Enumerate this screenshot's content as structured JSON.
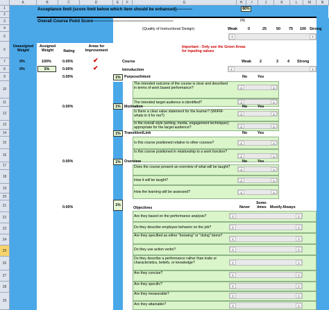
{
  "columns": [
    "A",
    "B",
    "C",
    "D",
    "E",
    "F",
    "G",
    "H",
    "I",
    "J",
    "K",
    "L",
    "M",
    "N"
  ],
  "rows": [
    "1",
    "2",
    "3",
    "4",
    "5",
    "6",
    "7",
    "8",
    "9",
    "10",
    "11",
    "12",
    "13",
    "14",
    "15",
    "16",
    "17",
    "18",
    "19",
    "20",
    "21",
    "22",
    "23",
    "24",
    "25",
    "26",
    "27",
    "28",
    "29"
  ],
  "acceptance": {
    "label": "Acceptance limit (score limit below which item should be enhanced)-----------",
    "value": "80%"
  },
  "overall": {
    "label": "Overall Course Point Score--------------------------------------------------------",
    "zero": "0%",
    "quality": "(Quality of Instructional Design)"
  },
  "scale_top": [
    "Weak",
    "0",
    "25",
    "50",
    "75",
    "100",
    "Strong"
  ],
  "headers": {
    "unassigned": "Unassigned Weight",
    "assigned": "Assigned Weight",
    "rating": "Rating",
    "areas": "Areas for Improvement"
  },
  "important": "Important - Only use the Green Areas for inputing values",
  "course": {
    "label": "Course",
    "unassigned": "0%",
    "assigned": "100%",
    "rating": "0.00%"
  },
  "course_scale": [
    "Weak",
    "2",
    "3",
    "4",
    "Strong"
  ],
  "intro": {
    "label": "Introduction",
    "unassigned": "0%",
    "assigned": "5%",
    "rating": "0.00%"
  },
  "sections": [
    {
      "label": "Purpose/Intent",
      "pct": "1%",
      "rating": "0.00%",
      "no": "No",
      "yes": "Yes",
      "questions": [
        "The intended outcome of the course is clear and described in terms of work based performance?",
        "The intended target audience is identified?"
      ]
    },
    {
      "label": "Motivation",
      "pct": "1%",
      "rating": "0.00%",
      "no": "No",
      "yes": "Yes",
      "questions": [
        "Is there a clear value statement for the learner? (WIIFM-whats in it for me?)",
        "Is the overall style (writing, media, engagement techniques) appropriate for the target audience?"
      ]
    },
    {
      "label": "Transition/Link",
      "pct": "1%",
      "rating": "0.00%",
      "no": "No",
      "yes": "Yes",
      "questions": [
        "Is this course positioned relative to other courses?",
        "Is this course positioned in relationship to a work function?"
      ]
    },
    {
      "label": "Overview",
      "pct": "1%",
      "rating": "0.00%",
      "no": "No",
      "yes": "Yes",
      "questions": [
        "Does the course present an overview of what will be taught?",
        "How it will be taught?",
        "How the learning will be assessed?"
      ]
    },
    {
      "label": "Objectives",
      "pct": "1%",
      "rating": "0.00%",
      "scale": [
        "Never",
        "Some-times",
        "Mostly",
        "Always"
      ],
      "questions": [
        "Are they based on the performance analysis?",
        "Do they describe employee behavior on the job?",
        "Are they specified as either \"knowing\" or \"doing\" items?",
        "Do they use action verbs?",
        "Do they describe a performance rather than traits or characteristics, beliefs, or knowledge?",
        "Are they concise?",
        "Are they specific?",
        "Are they measurable?",
        "Are they attainable?"
      ]
    }
  ],
  "arrows": {
    "left": "‹",
    "right": "›"
  },
  "check_mark": "✔",
  "colors": {
    "blue": "#4aa8e8",
    "green": "#d9f5c9",
    "black": "#000000",
    "red": "#cc0000"
  }
}
